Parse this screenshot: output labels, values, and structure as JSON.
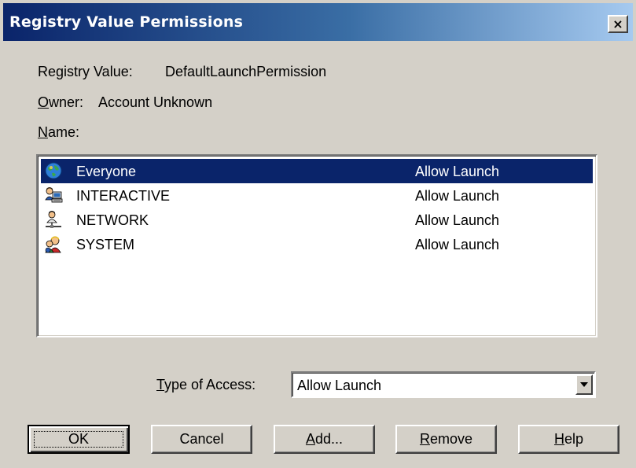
{
  "window": {
    "title": "Registry Value Permissions",
    "close_glyph": "×"
  },
  "info": {
    "registry_value_label": "Registry Value:",
    "registry_value": "DefaultLaunchPermission",
    "owner_label_first": "O",
    "owner_label_rest": "wner:",
    "owner_value": "Account Unknown",
    "name_label_first": "N",
    "name_label_rest": "ame:"
  },
  "accounts": [
    {
      "icon": "globe-icon",
      "name": "Everyone",
      "access": "Allow Launch",
      "selected": true
    },
    {
      "icon": "interactive-users-icon",
      "name": "INTERACTIVE",
      "access": "Allow Launch",
      "selected": false
    },
    {
      "icon": "network-user-icon",
      "name": "NETWORK",
      "access": "Allow Launch",
      "selected": false
    },
    {
      "icon": "system-users-icon",
      "name": "SYSTEM",
      "access": "Allow Launch",
      "selected": false
    }
  ],
  "type_of_access": {
    "label_first": "T",
    "label_rest": "ype of Access:",
    "selected": "Allow Launch"
  },
  "buttons": {
    "ok": "OK",
    "cancel": "Cancel",
    "add_first": "A",
    "add_rest": "dd...",
    "remove_first": "R",
    "remove_rest": "emove",
    "help_first": "H",
    "help_rest": "elp"
  },
  "colors": {
    "face": "#d4d0c8",
    "title_start": "#0a246a",
    "title_end": "#a6caf0",
    "selection": "#0a246a"
  }
}
